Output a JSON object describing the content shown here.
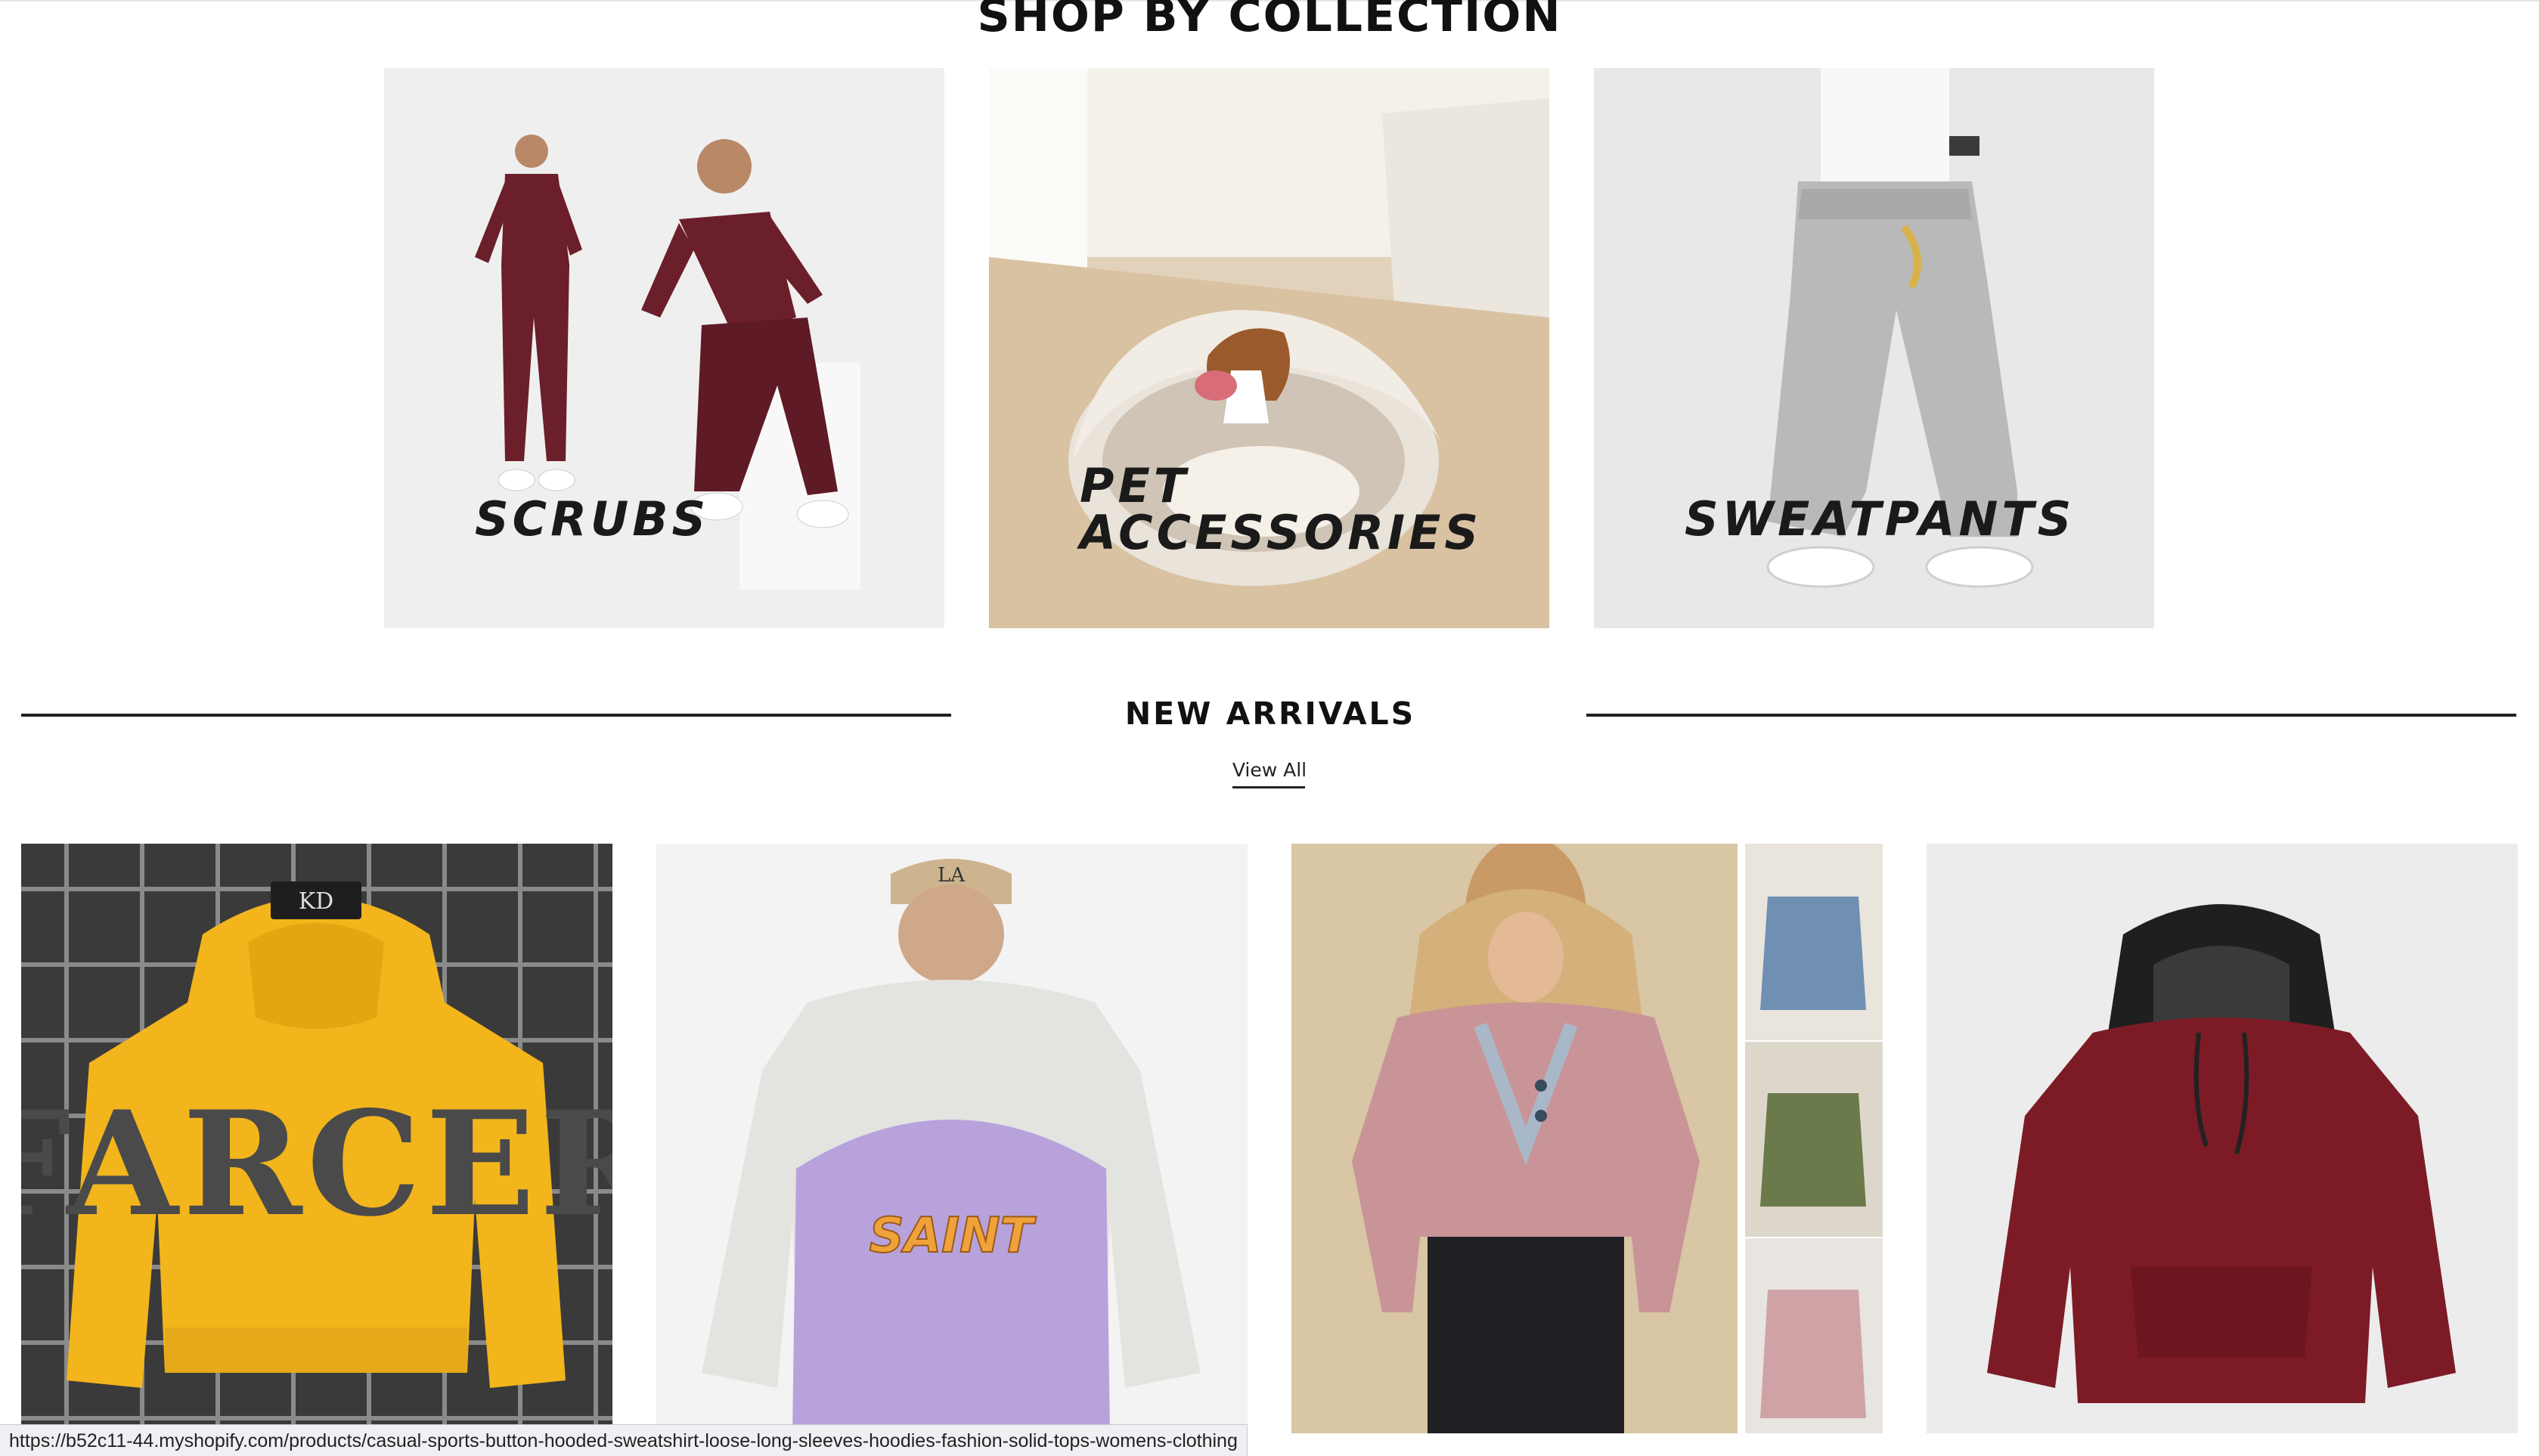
{
  "collections": {
    "title": "SHOP BY COLLECTION",
    "items": [
      {
        "label_lines": [
          "SCRUBS"
        ]
      },
      {
        "label_lines": [
          "PET",
          "ACCESSORIES"
        ]
      },
      {
        "label_lines": [
          "SWEATPANTS"
        ]
      }
    ]
  },
  "new_arrivals": {
    "title": "NEW ARRIVALS",
    "view_all_label": "View All",
    "products": [
      {
        "graphic_text": "FARCER",
        "tag_text": "KD"
      },
      {
        "graphic_text": "SAINT",
        "cap_text": "LA"
      },
      {
        "graphic_text": ""
      },
      {
        "graphic_text": ""
      }
    ]
  },
  "status_bar": {
    "url": "https://b52c11-44.myshopify.com/products/casual-sports-button-hooded-sweatshirt-loose-long-sleeves-hoodies-fashion-solid-tops-womens-clothing"
  },
  "colors": {
    "scrubs": "#6b1f2a",
    "hoodie_yellow": "#f2b51c",
    "hoodie_lavender": "#b7a2dc",
    "hoodie_pink": "#c99497",
    "hoodie_burgundy": "#7c1b26",
    "sweatpants_grey": "#b9b9b9"
  }
}
